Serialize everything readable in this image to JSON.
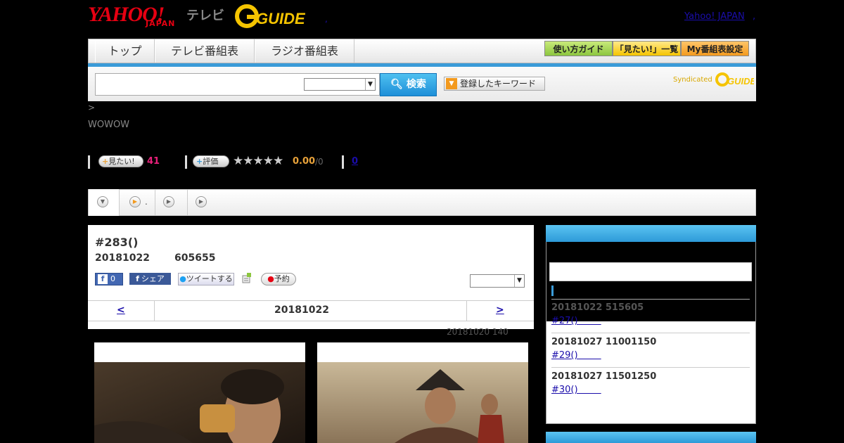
{
  "header": {
    "yahoo_logo": "YAHOO!",
    "japan_text": "JAPAN",
    "tv_text": "テレビ",
    "gguide_logo": "G-GUIDE",
    "header_dot": ",",
    "yahoo_link": "Yahoo! JAPAN",
    "yahoo_link_sep": ","
  },
  "nav": {
    "tabs": [
      "トップ",
      "テレビ番組表",
      "ラジオ番組表"
    ],
    "buttons": [
      "使い方ガイド",
      "「見たい!」一覧",
      "My番組表設定"
    ]
  },
  "search": {
    "input_value": "",
    "select_value": "",
    "button_label": "検索",
    "keyword_button": "登録したキーワード",
    "syndicated": "Syndicated"
  },
  "breadcrumb": ">",
  "channel": "WOWOW",
  "stats": {
    "want_label": "見たい!",
    "want_count": "41",
    "rate_label": "評価",
    "stars": "★★★★★",
    "score": "0.00",
    "score_of": "/0",
    "review_count": "0"
  },
  "program": {
    "title": "#283()",
    "date": "20181022",
    "time": "605655",
    "fb_like_count": "0",
    "fb_share": "シェア",
    "tweet": "ツイートする",
    "reserve": "予約",
    "day_prev": "<",
    "day_current": "20181022",
    "day_next": ">",
    "update_note": "20181020  140"
  },
  "tabs_bar": {
    "tab2_text": "."
  },
  "sidebar": {
    "items": [
      {
        "time": "20181022  515605",
        "link": "#27()        "
      },
      {
        "time": "20181027  11001150",
        "link": "#29()        "
      },
      {
        "time": "20181027  11501250",
        "link": "#30()        "
      }
    ]
  },
  "colors": {
    "accent_blue": "#3a9bd8",
    "want_pink": "#e8207a",
    "score_orange": "#e8a23a",
    "yahoo_red": "#e60012"
  }
}
